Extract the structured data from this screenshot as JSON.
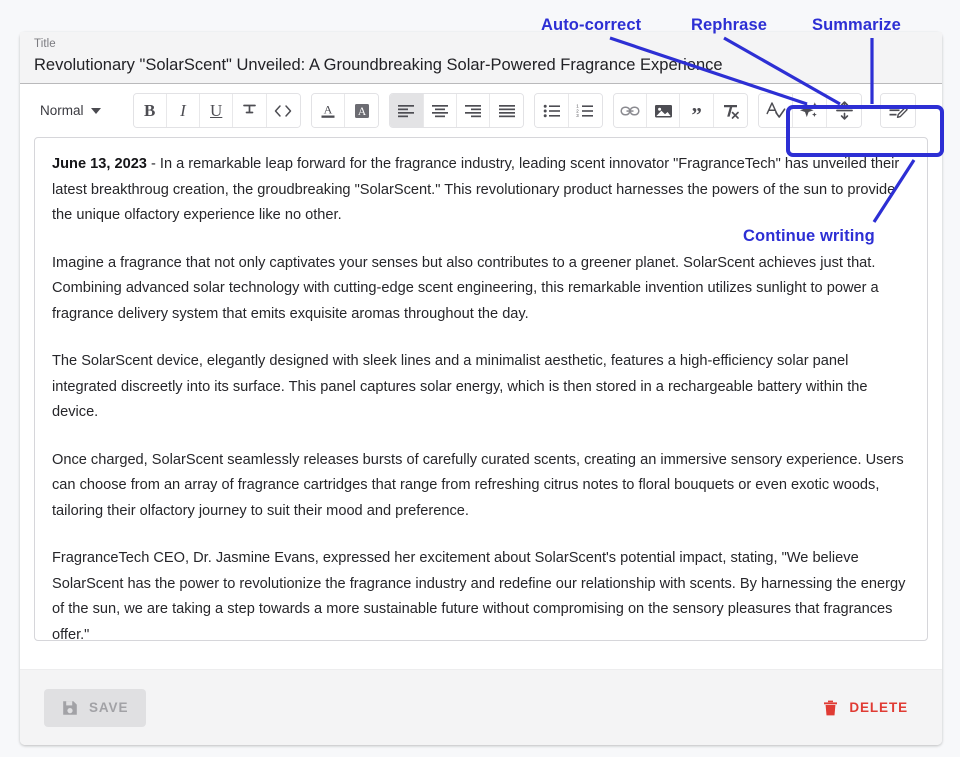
{
  "title_field": {
    "label": "Title",
    "value": "Revolutionary \"SolarScent\" Unveiled: A Groundbreaking Solar-Powered Fragrance Experience"
  },
  "toolbar": {
    "style_select": {
      "value": "Normal",
      "caret_icon": "chevron-down-icon"
    },
    "groups": [
      {
        "name": "text-format",
        "buttons": [
          {
            "name": "bold-button",
            "icon": "bold-icon",
            "label": "B"
          },
          {
            "name": "italic-button",
            "icon": "italic-icon",
            "label": "I"
          },
          {
            "name": "underline-button",
            "icon": "underline-icon",
            "label": "U"
          },
          {
            "name": "strikethrough-button",
            "icon": "strikethrough-icon",
            "label": "S"
          },
          {
            "name": "code-button",
            "icon": "code-icon",
            "label": "<>"
          }
        ]
      },
      {
        "name": "color",
        "buttons": [
          {
            "name": "text-color-button",
            "icon": "text-color-icon",
            "label": "A"
          },
          {
            "name": "highlight-color-button",
            "icon": "highlight-color-icon",
            "label": "A"
          }
        ]
      },
      {
        "name": "alignment",
        "buttons": [
          {
            "name": "align-left-button",
            "icon": "align-left-icon",
            "active": true
          },
          {
            "name": "align-center-button",
            "icon": "align-center-icon",
            "active": false
          },
          {
            "name": "align-right-button",
            "icon": "align-right-icon",
            "active": false
          },
          {
            "name": "align-justify-button",
            "icon": "align-justify-icon",
            "active": false
          }
        ]
      },
      {
        "name": "lists",
        "buttons": [
          {
            "name": "bulleted-list-button",
            "icon": "bulleted-list-icon"
          },
          {
            "name": "numbered-list-button",
            "icon": "numbered-list-icon"
          }
        ]
      },
      {
        "name": "insert",
        "buttons": [
          {
            "name": "insert-link-button",
            "icon": "link-icon"
          },
          {
            "name": "insert-image-button",
            "icon": "image-icon"
          },
          {
            "name": "blockquote-button",
            "icon": "quote-icon"
          },
          {
            "name": "clear-formatting-button",
            "icon": "clear-formatting-icon"
          }
        ]
      }
    ],
    "ai_buttons": [
      {
        "name": "auto-correct-button",
        "icon": "a-checkmark-icon",
        "title": "Auto-correct"
      },
      {
        "name": "rephrase-button",
        "icon": "sparkles-icon",
        "title": "Rephrase"
      },
      {
        "name": "summarize-button",
        "icon": "compress-icon",
        "title": "Summarize"
      },
      {
        "name": "continue-writing-button",
        "icon": "lines-pencil-icon",
        "title": "Continue writing"
      }
    ]
  },
  "document": {
    "paragraphs": [
      {
        "datestamp": "June 13, 2023",
        "text": " - In a remarkable leap forward for the fragrance industry, leading scent innovator \"FragranceTech\" has unveiled their latest breakthroug creation, the groudbreaking \"SolarScent.\" This revolutionary product harnesses the powers of the sun to provide the unique olfactory experience like no other."
      },
      {
        "datestamp": "",
        "text": "Imagine a fragrance that not only captivates your senses but also contributes to a greener planet. SolarScent achieves just that. Combining advanced solar technology with cutting-edge scent engineering, this remarkable invention utilizes sunlight to power a fragrance delivery system that emits exquisite aromas throughout the day."
      },
      {
        "datestamp": "",
        "text": "The SolarScent device, elegantly designed with sleek lines and a minimalist aesthetic, features a high-efficiency solar panel integrated discreetly into its surface. This panel captures solar energy, which is then stored in a rechargeable battery within the device."
      },
      {
        "datestamp": "",
        "text": "Once charged, SolarScent seamlessly releases bursts of carefully curated scents, creating an immersive sensory experience. Users can choose from an array of fragrance cartridges that range from refreshing citrus notes to floral bouquets or even exotic woods, tailoring their olfactory journey to suit their mood and preference."
      },
      {
        "datestamp": "",
        "text": "FragranceTech CEO, Dr. Jasmine Evans, expressed her excitement about SolarScent's potential impact, stating, \"We believe SolarScent has the power to revolutionize the fragrance industry and redefine our relationship with scents. By harnessing the energy of the sun, we are taking a step towards a more sustainable future without compromising on the sensory pleasures that fragrances offer.\""
      }
    ]
  },
  "footer": {
    "save_label": "SAVE",
    "save_icon": "floppy-disk-icon",
    "delete_label": "DELETE",
    "delete_icon": "trash-icon"
  },
  "annotations": {
    "color": "#2d2fd4",
    "labels": [
      {
        "name": "annotation-auto-correct",
        "text": "Auto-correct"
      },
      {
        "name": "annotation-rephrase",
        "text": "Rephrase"
      },
      {
        "name": "annotation-summarize",
        "text": "Summarize"
      },
      {
        "name": "annotation-continue-writing",
        "text": "Continue writing"
      }
    ]
  }
}
